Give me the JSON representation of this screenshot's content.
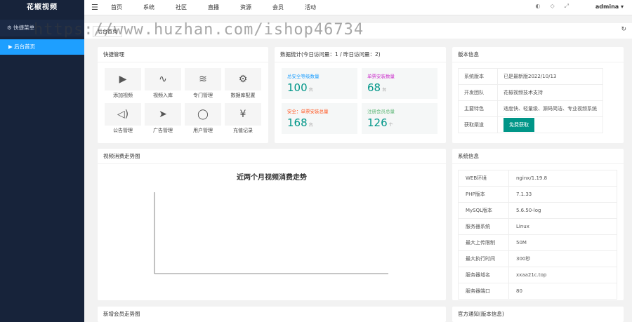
{
  "sidebar": {
    "logo": "花椒视频",
    "section": "快捷菜单",
    "item": "后台首页"
  },
  "topbar": {
    "nav": [
      "首页",
      "系统",
      "社区",
      "直播",
      "资源",
      "会员",
      "活动"
    ],
    "user": "admina"
  },
  "tabbar": {
    "tab": "后台首页"
  },
  "watermark": "https://www.huzhan.com/ishop46734",
  "quick": {
    "title": "快捷管理",
    "items": [
      {
        "label": "添加视频",
        "icon": "play-icon"
      },
      {
        "label": "视频入库",
        "icon": "pulse-icon"
      },
      {
        "label": "专门管理",
        "icon": "layers-icon"
      },
      {
        "label": "数据库配置",
        "icon": "gear-icon"
      },
      {
        "label": "公告管理",
        "icon": "speaker-icon"
      },
      {
        "label": "广告管理",
        "icon": "send-icon"
      },
      {
        "label": "用户管理",
        "icon": "user-icon"
      },
      {
        "label": "充值记录",
        "icon": "yen-icon"
      }
    ]
  },
  "stats": {
    "title": "数据统计(今日访问量：1 / 昨日访问量：2)",
    "items": [
      {
        "label": "总安全等级数量",
        "value": "100",
        "unit": "台",
        "label_color": "#1e9fff"
      },
      {
        "label": "单票安装数量",
        "value": "68",
        "unit": "台",
        "label_color": "#cc33cc"
      },
      {
        "label": "安全：单票安装总量",
        "value": "168",
        "unit": "台",
        "label_color": "#ff5722"
      },
      {
        "label": "注册会员总量",
        "value": "126",
        "unit": "个",
        "label_color": "#5fb878"
      }
    ]
  },
  "version": {
    "title": "版本信息",
    "rows": [
      {
        "key": "系统版本",
        "value": "已是最新版2022/10/13"
      },
      {
        "key": "开发团队",
        "value": "花椒视频技术支持"
      },
      {
        "key": "主要特色",
        "value": "适度快、轻量级、源码简洁、专业视频系统"
      },
      {
        "key": "获取渠道",
        "button": "免费获取"
      }
    ]
  },
  "chart_card": {
    "title": "视频消费走势图"
  },
  "chart_data": {
    "type": "line",
    "title": "近两个月视频消费走势",
    "xlabel": "",
    "ylabel": "",
    "series": []
  },
  "sysinfo": {
    "title": "系统信息",
    "rows": [
      {
        "key": "WEB环境",
        "value": "nginx/1.19.8"
      },
      {
        "key": "PHP版本",
        "value": "7.1.33"
      },
      {
        "key": "MySQL版本",
        "value": "5.6.50-log"
      },
      {
        "key": "服务器系统",
        "value": "Linux"
      },
      {
        "key": "最大上传限制",
        "value": "50M"
      },
      {
        "key": "最大执行时间",
        "value": "300秒"
      },
      {
        "key": "服务器域名",
        "value": "xxaa21c.top"
      },
      {
        "key": "服务器端口",
        "value": "80"
      }
    ]
  },
  "members_card": {
    "title": "新增会员走势图"
  },
  "notice_card": {
    "title": "官方通知(版本信息)"
  },
  "colors": {
    "sidebar": "#17233a",
    "accent": "#1e9fff",
    "green": "#009688"
  }
}
